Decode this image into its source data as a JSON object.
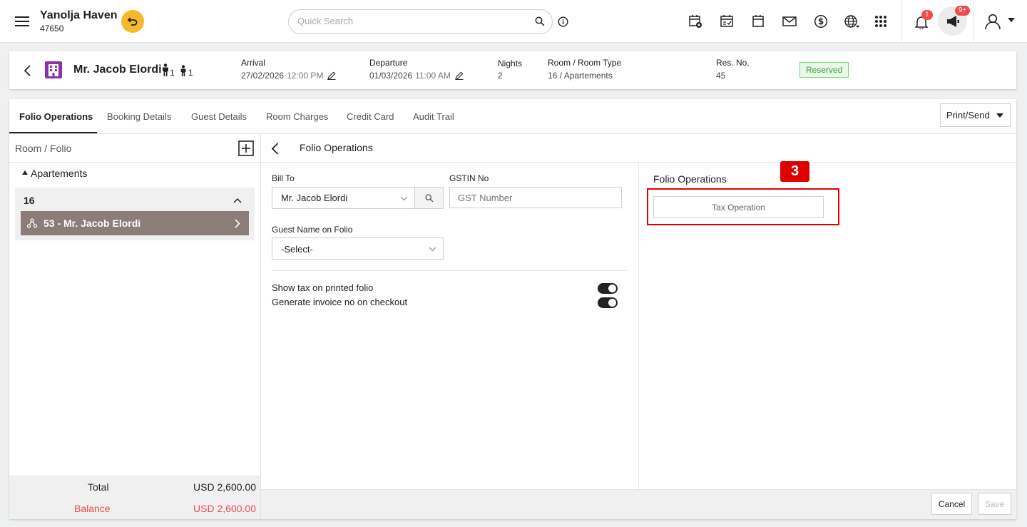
{
  "header": {
    "hotel_name": "Yanolja Haven",
    "hotel_code": "47650",
    "search_placeholder": "Quick Search",
    "notifications_badge": "1",
    "announcements_badge": "9+"
  },
  "reservation": {
    "guest_name": "Mr. Jacob Elordi",
    "adults": "1",
    "children": "1",
    "arrival_label": "Arrival",
    "arrival_date": "27/02/2026",
    "arrival_time": "12:00 PM",
    "departure_label": "Departure",
    "departure_date": "01/03/2026",
    "departure_time": "11:00 AM",
    "nights_label": "Nights",
    "nights": "2",
    "room_label": "Room / Room Type",
    "room_value": "16 / Apartements",
    "resno_label": "Res. No.",
    "resno": "45",
    "status": "Reserved"
  },
  "tabs": [
    {
      "label": "Folio Operations"
    },
    {
      "label": "Booking Details"
    },
    {
      "label": "Guest Details"
    },
    {
      "label": "Room Charges"
    },
    {
      "label": "Credit Card"
    },
    {
      "label": "Audit Trail"
    }
  ],
  "print_send_label": "Print/Send",
  "left_panel": {
    "title": "Room / Folio",
    "group_label": "Apartements",
    "room_number": "16",
    "folio_item": "53 - Mr. Jacob Elordi",
    "total_label": "Total",
    "total_value": "USD 2,600.00",
    "balance_label": "Balance",
    "balance_value": "USD 2,600.00"
  },
  "folio_form": {
    "title": "Folio Operations",
    "bill_to_label": "Bill To",
    "bill_to_value": "Mr. Jacob Elordi",
    "gstin_label": "GSTIN No",
    "gstin_placeholder": "GST Number",
    "guest_name_label": "Guest Name on Folio",
    "guest_name_value": "-Select-",
    "show_tax_label": "Show tax on printed folio",
    "generate_invoice_label": "Generate invoice no on checkout"
  },
  "operations": {
    "title": "Folio Operations",
    "step_number": "3",
    "tax_operation_label": "Tax Operation"
  },
  "footer": {
    "cancel_label": "Cancel",
    "save_label": "Save"
  },
  "colors": {
    "accent": "#f7b92b",
    "status_green": "#3a9a3a",
    "badge_red": "#f24b4b",
    "balance_red": "#f24b4b",
    "selected_row": "#8c7d78",
    "highlight_red": "#e00000"
  }
}
